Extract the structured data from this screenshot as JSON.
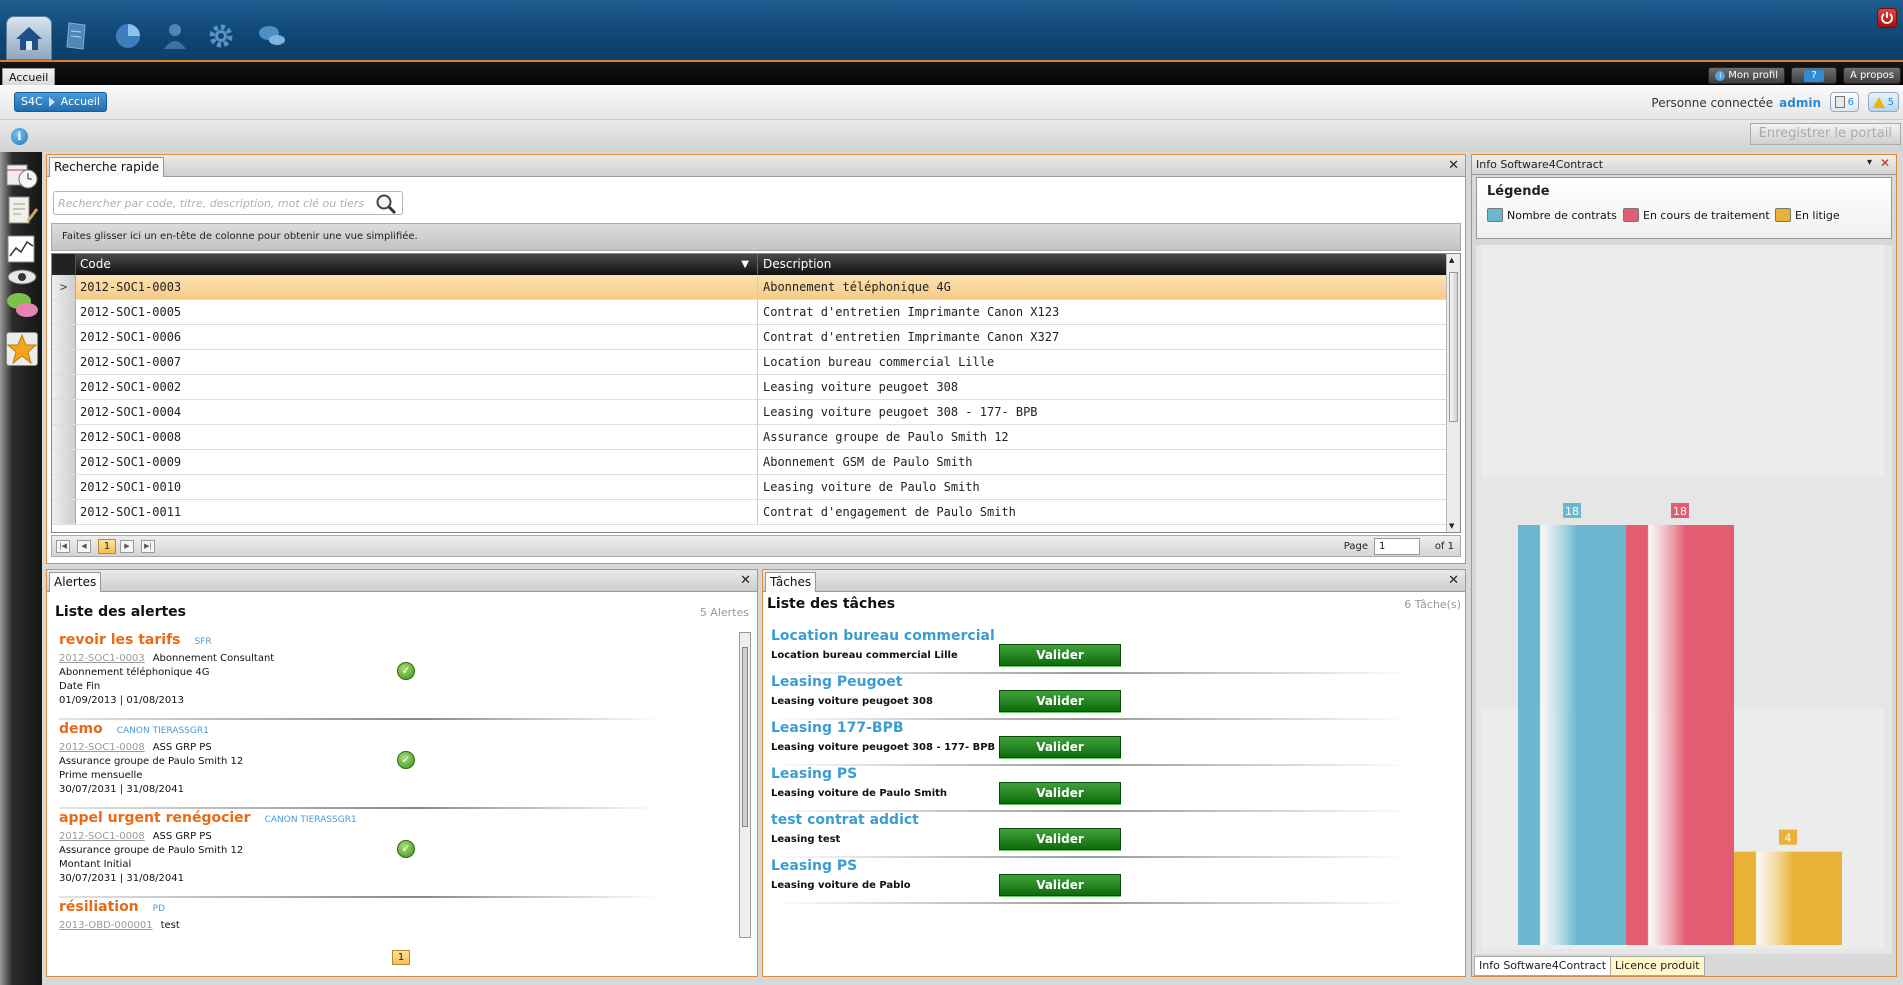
{
  "topbar": {
    "icons": [
      "home-icon",
      "contract-icon",
      "pie-chart-icon",
      "user-icon",
      "gear-icon",
      "chat-icon"
    ],
    "power_icon": "power-icon"
  },
  "tabs": {
    "active": "Accueil"
  },
  "top_buttons": {
    "profile": "Mon profil",
    "help": "?",
    "about": "A propos"
  },
  "breadcrumb": {
    "root": "S4C",
    "current": "Accueil"
  },
  "session": {
    "label": "Personne connectée",
    "user": "admin",
    "docs_count": "6",
    "alerts_count": "5"
  },
  "save_portal": "Enregistrer le portail",
  "quick_search": {
    "tab": "Recherche rapide",
    "placeholder": "Rechercher par code, titre, description, mot clé ou tiers",
    "group_hint": "Faites glisser ici un en-tête de colonne pour obtenir une vue simplifiée.",
    "columns": {
      "code": "Code",
      "description": "Description"
    },
    "rows": [
      {
        "code": "2012-SOC1-0003",
        "description": "Abonnement téléphonique 4G"
      },
      {
        "code": "2012-SOC1-0005",
        "description": "Contrat d'entretien Imprimante Canon X123"
      },
      {
        "code": "2012-SOC1-0006",
        "description": "Contrat d'entretien Imprimante Canon X327"
      },
      {
        "code": "2012-SOC1-0007",
        "description": "Location bureau commercial Lille"
      },
      {
        "code": "2012-SOC1-0002",
        "description": "Leasing voiture peugoet 308"
      },
      {
        "code": "2012-SOC1-0004",
        "description": "Leasing voiture peugoet 308 - 177- BPB"
      },
      {
        "code": "2012-SOC1-0008",
        "description": "Assurance groupe de Paulo Smith 12"
      },
      {
        "code": "2012-SOC1-0009",
        "description": "Abonnement GSM de Paulo Smith"
      },
      {
        "code": "2012-SOC1-0010",
        "description": "Leasing voiture de Paulo Smith"
      },
      {
        "code": "2012-SOC1-0011",
        "description": "Contrat d'engagement de Paulo Smith"
      }
    ],
    "pager": {
      "current": "1",
      "page_label": "Page",
      "page_value": "1",
      "of_label": "of 1"
    }
  },
  "alerts": {
    "tab": "Alertes",
    "title": "Liste des alertes",
    "count": "5 Alertes",
    "items": [
      {
        "title": "revoir les tarifs",
        "tags": "SFR",
        "code": "2012-SOC1-0003",
        "type": "Abonnement Consultant",
        "desc": "Abonnement téléphonique 4G",
        "field": "Date Fin",
        "dates": "01/09/2013 | 01/08/2013"
      },
      {
        "title": "demo",
        "tags": "CANON    TIERASSGR1",
        "code": "2012-SOC1-0008",
        "type": "ASS GRP PS",
        "desc": "Assurance groupe de Paulo Smith 12",
        "field": "Prime mensuelle",
        "dates": "30/07/2031 | 31/08/2041"
      },
      {
        "title": "appel urgent renégocier",
        "tags": "CANON    TIERASSGR1",
        "code": "2012-SOC1-0008",
        "type": "ASS GRP PS",
        "desc": "Assurance groupe de Paulo Smith 12",
        "field": "Montant Initial",
        "dates": "30/07/2031 | 31/08/2041"
      },
      {
        "title": "résiliation",
        "tags": "PD",
        "code": "2013-OBD-000001",
        "type": "test",
        "desc": "",
        "field": "",
        "dates": ""
      }
    ],
    "pager": "1"
  },
  "tasks": {
    "tab": "Tâches",
    "title": "Liste des tâches",
    "count": "6 Tâche(s)",
    "button": "Valider",
    "items": [
      {
        "title": "Location bureau commercial",
        "sub": "Location bureau commercial Lille"
      },
      {
        "title": "Leasing Peugoet",
        "sub": "Leasing voiture peugoet 308"
      },
      {
        "title": "Leasing 177-BPB",
        "sub": "Leasing voiture peugoet 308 - 177- BPB"
      },
      {
        "title": "Leasing PS",
        "sub": "Leasing voiture de Paulo Smith"
      },
      {
        "title": "test contrat addict",
        "sub": "Leasing test"
      },
      {
        "title": "Leasing PS",
        "sub": "Leasing voiture de Pablo"
      }
    ]
  },
  "info": {
    "tab": "Info Software4Contract",
    "legend_title": "Légende",
    "bottom_tabs": [
      "Info Software4Contract",
      "Licence produit"
    ]
  },
  "chart_data": {
    "type": "bar",
    "categories": [
      "Nombre de contrats",
      "En cours de traitement",
      "En litige"
    ],
    "series": [
      {
        "name": "Nombre de contrats",
        "values": [
          18,
          null,
          null
        ]
      },
      {
        "name": "En cours de traitement",
        "values": [
          null,
          18,
          null
        ]
      },
      {
        "name": "En litige",
        "values": [
          null,
          null,
          4
        ]
      }
    ],
    "values": [
      18,
      18,
      4
    ],
    "labels": [
      "18",
      "18",
      "4"
    ],
    "colors": [
      "#6bb7cf",
      "#e45c72",
      "#e9b135"
    ],
    "ylim": [
      0,
      18
    ],
    "legend": "top"
  }
}
